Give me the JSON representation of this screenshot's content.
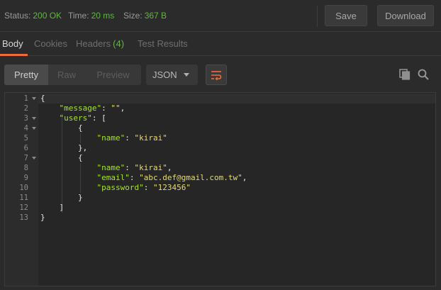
{
  "status": {
    "status_label": "Status:",
    "status_value": "200 OK",
    "time_label": "Time:",
    "time_value": "20 ms",
    "size_label": "Size:",
    "size_value": "367 B"
  },
  "actions": {
    "save_label": "Save",
    "download_label": "Download"
  },
  "tabs": [
    {
      "label": "Body",
      "active": true
    },
    {
      "label": "Cookies"
    },
    {
      "label": "Headers",
      "count": "(4)"
    },
    {
      "label": "Test Results"
    }
  ],
  "view_modes": [
    "Pretty",
    "Raw",
    "Preview"
  ],
  "format": {
    "selected": "JSON"
  },
  "icons": {
    "wrap": "wrap-lines-icon",
    "copy": "copy-icon",
    "search": "search-icon"
  },
  "colors": {
    "accent": "#f26b3a",
    "ok": "#63b543",
    "key": "#a6e22e",
    "string": "#e6db74"
  },
  "code": {
    "line_numbers": [
      "1",
      "2",
      "3",
      "4",
      "5",
      "6",
      "7",
      "8",
      "9",
      "10",
      "11",
      "12",
      "13"
    ],
    "lines": [
      {
        "t": [
          [
            "p",
            "{"
          ]
        ]
      },
      {
        "t": [
          [
            "p",
            "    "
          ],
          [
            "k",
            "\"message\""
          ],
          [
            "p",
            ": "
          ],
          [
            "s",
            "\"\""
          ],
          [
            "p",
            ","
          ]
        ]
      },
      {
        "t": [
          [
            "p",
            "    "
          ],
          [
            "k",
            "\"users\""
          ],
          [
            "p",
            ": ["
          ]
        ]
      },
      {
        "t": [
          [
            "p",
            "        {"
          ]
        ]
      },
      {
        "t": [
          [
            "p",
            "            "
          ],
          [
            "k",
            "\"name\""
          ],
          [
            "p",
            ": "
          ],
          [
            "s",
            "\"kirai\""
          ]
        ]
      },
      {
        "t": [
          [
            "p",
            "        },"
          ]
        ]
      },
      {
        "t": [
          [
            "p",
            "        {"
          ]
        ]
      },
      {
        "t": [
          [
            "p",
            "            "
          ],
          [
            "k",
            "\"name\""
          ],
          [
            "p",
            ": "
          ],
          [
            "s",
            "\"kirai\""
          ],
          [
            "p",
            ","
          ]
        ]
      },
      {
        "t": [
          [
            "p",
            "            "
          ],
          [
            "k",
            "\"email\""
          ],
          [
            "p",
            ": "
          ],
          [
            "s",
            "\"abc.def@gmail.com.tw\""
          ],
          [
            "p",
            ","
          ]
        ]
      },
      {
        "t": [
          [
            "p",
            "            "
          ],
          [
            "k",
            "\"password\""
          ],
          [
            "p",
            ": "
          ],
          [
            "s",
            "\"123456\""
          ]
        ]
      },
      {
        "t": [
          [
            "p",
            "        }"
          ]
        ]
      },
      {
        "t": [
          [
            "p",
            "    ]"
          ]
        ]
      },
      {
        "t": [
          [
            "p",
            "}"
          ]
        ]
      }
    ]
  }
}
